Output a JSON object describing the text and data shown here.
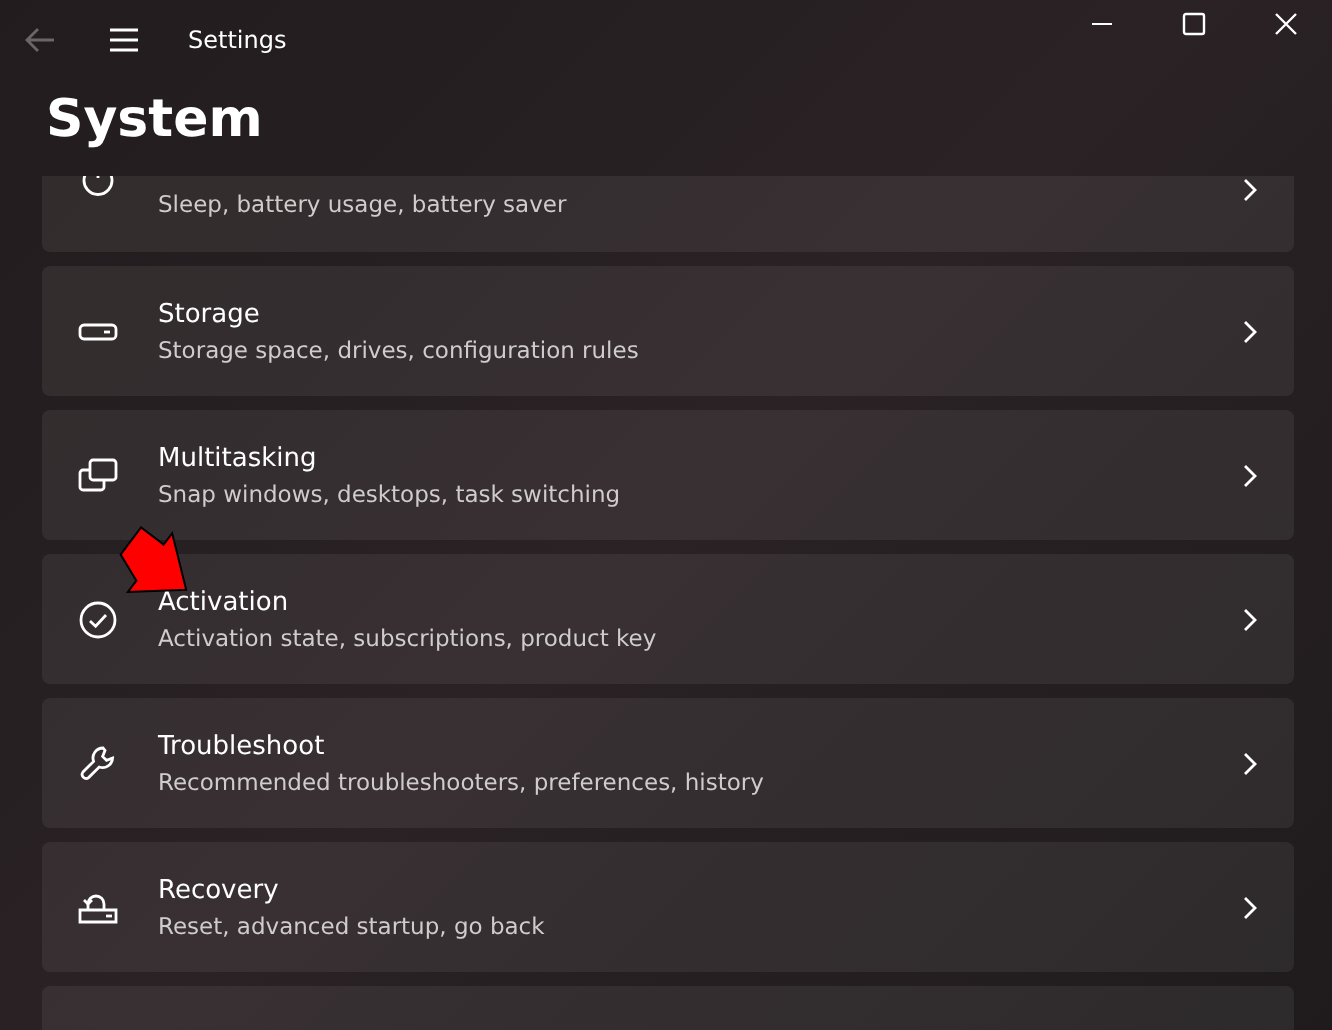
{
  "window": {
    "title": "Settings"
  },
  "page": {
    "title": "System"
  },
  "items": [
    {
      "kind": "power",
      "description": "Sleep, battery usage, battery saver"
    },
    {
      "kind": "storage",
      "title": "Storage",
      "description": "Storage space, drives, configuration rules"
    },
    {
      "kind": "multitasking",
      "title": "Multitasking",
      "description": "Snap windows, desktops, task switching"
    },
    {
      "kind": "activation",
      "title": "Activation",
      "description": "Activation state, subscriptions, product key",
      "annotated": true
    },
    {
      "kind": "troubleshoot",
      "title": "Troubleshoot",
      "description": "Recommended troubleshooters, preferences, history"
    },
    {
      "kind": "recovery",
      "title": "Recovery",
      "description": "Reset, advanced startup, go back"
    },
    {
      "kind": "blank"
    }
  ]
}
